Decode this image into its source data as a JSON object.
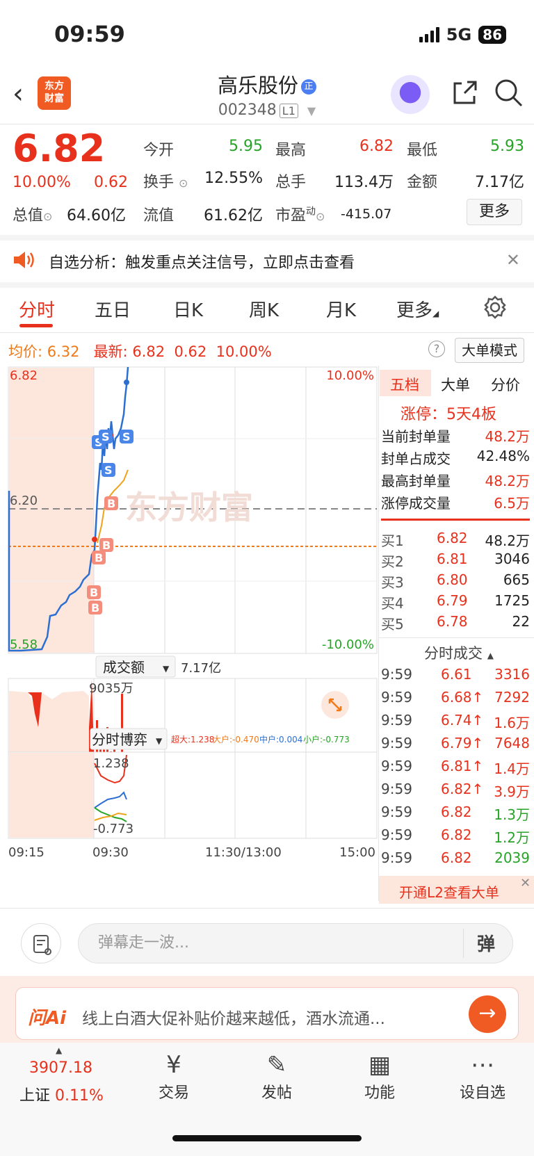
{
  "status": {
    "time": "09:59",
    "network": "5G",
    "battery": "86"
  },
  "header": {
    "logo_line1": "东方",
    "logo_line2": "财富",
    "stock_name": "高乐股份",
    "badge": "正",
    "stock_code": "002348",
    "level": "L1"
  },
  "quote": {
    "price": "6.82",
    "pct": "10.00%",
    "change": "0.62",
    "open_label": "今开",
    "open": "5.95",
    "high_label": "最高",
    "high": "6.82",
    "low_label": "最低",
    "low": "5.93",
    "turnover_label": "换手",
    "turnover": "12.55%",
    "volume_label": "总手",
    "volume": "113.4万",
    "amount_label": "金额",
    "amount": "7.17亿",
    "mcap_label": "总值",
    "mcap": "64.60亿",
    "float_label": "流值",
    "float": "61.62亿",
    "pe_label": "市盈",
    "pe_sup": "动",
    "pe": "-415.07",
    "more": "更多"
  },
  "notice": {
    "text": "自选分析：触发重点关注信号，立即点击查看"
  },
  "tabs": [
    "分时",
    "五日",
    "日K",
    "周K",
    "月K",
    "更多"
  ],
  "info": {
    "avg_label": "均价:",
    "avg": "6.32",
    "latest_label": "最新:",
    "latest": "6.82",
    "chg": "0.62",
    "pct": "10.00%",
    "help": "?",
    "bigorder": "大单模式"
  },
  "chart": {
    "top_price": "6.82",
    "top_pct": "10.00%",
    "mid_price": "6.20",
    "bottom_price": "5.58",
    "bottom_pct": "-10.00%",
    "vol_selector": "成交额",
    "vol_total": "7.17亿",
    "vol_max": "9035万",
    "game_selector": "分时博弈",
    "game_legend": [
      {
        "label": "超大:1.238",
        "color": "#e8311c"
      },
      {
        "label": "大户:-0.470",
        "color": "#f07a1a"
      },
      {
        "label": "中户:0.004",
        "color": "#2d6fd1"
      },
      {
        "label": "小户:-0.773",
        "color": "#27a327"
      }
    ],
    "game_max": "1.238",
    "game_min": "-0.773",
    "times": [
      "09:15",
      "09:30",
      "11:30/13:00",
      "15:00"
    ],
    "watermark": "东方财富"
  },
  "panel": {
    "tabs": [
      "五档",
      "大单",
      "分价"
    ],
    "limit_title": "涨停：5天4板",
    "seal_rows": [
      {
        "label": "当前封单量",
        "value": "48.2万"
      },
      {
        "label": "封单占成交",
        "value": "42.48%"
      },
      {
        "label": "最高封单量",
        "value": "48.2万"
      },
      {
        "label": "涨停成交量",
        "value": "6.5万"
      }
    ],
    "bids": [
      {
        "label": "买1",
        "price": "6.82",
        "vol": "48.2万"
      },
      {
        "label": "买2",
        "price": "6.81",
        "vol": "3046"
      },
      {
        "label": "买3",
        "price": "6.80",
        "vol": "665"
      },
      {
        "label": "买4",
        "price": "6.79",
        "vol": "1725"
      },
      {
        "label": "买5",
        "price": "6.78",
        "vol": "22"
      }
    ],
    "ticks_title": "分时成交",
    "ticks": [
      {
        "time": "9:59",
        "price": "6.61",
        "vol": "3316",
        "vc": "red"
      },
      {
        "time": "9:59",
        "price": "6.68↑",
        "vol": "7292",
        "vc": "red"
      },
      {
        "time": "9:59",
        "price": "6.74↑",
        "vol": "1.6万",
        "vc": "red"
      },
      {
        "time": "9:59",
        "price": "6.79↑",
        "vol": "7648",
        "vc": "red"
      },
      {
        "time": "9:59",
        "price": "6.81↑",
        "vol": "1.4万",
        "vc": "red"
      },
      {
        "time": "9:59",
        "price": "6.82↑",
        "vol": "3.9万",
        "vc": "red"
      },
      {
        "time": "9:59",
        "price": "6.82",
        "vol": "1.3万",
        "vc": "green"
      },
      {
        "time": "9:59",
        "price": "6.82",
        "vol": "1.2万",
        "vc": "green"
      },
      {
        "time": "9:59",
        "price": "6.82",
        "vol": "2039",
        "vc": "green"
      }
    ],
    "l2_banner": "开通L2查看大单"
  },
  "comment": {
    "placeholder": "弹幕走一波...",
    "danmu": "弹"
  },
  "ai": {
    "logo": "问Ai",
    "text": "线上白酒大促补贴价越来越低，酒水流通..."
  },
  "nav": {
    "index_value": "3907.18",
    "index_name": "上证",
    "index_pct": "0.11%",
    "items": [
      "交易",
      "发帖",
      "功能",
      "设自选"
    ]
  }
}
